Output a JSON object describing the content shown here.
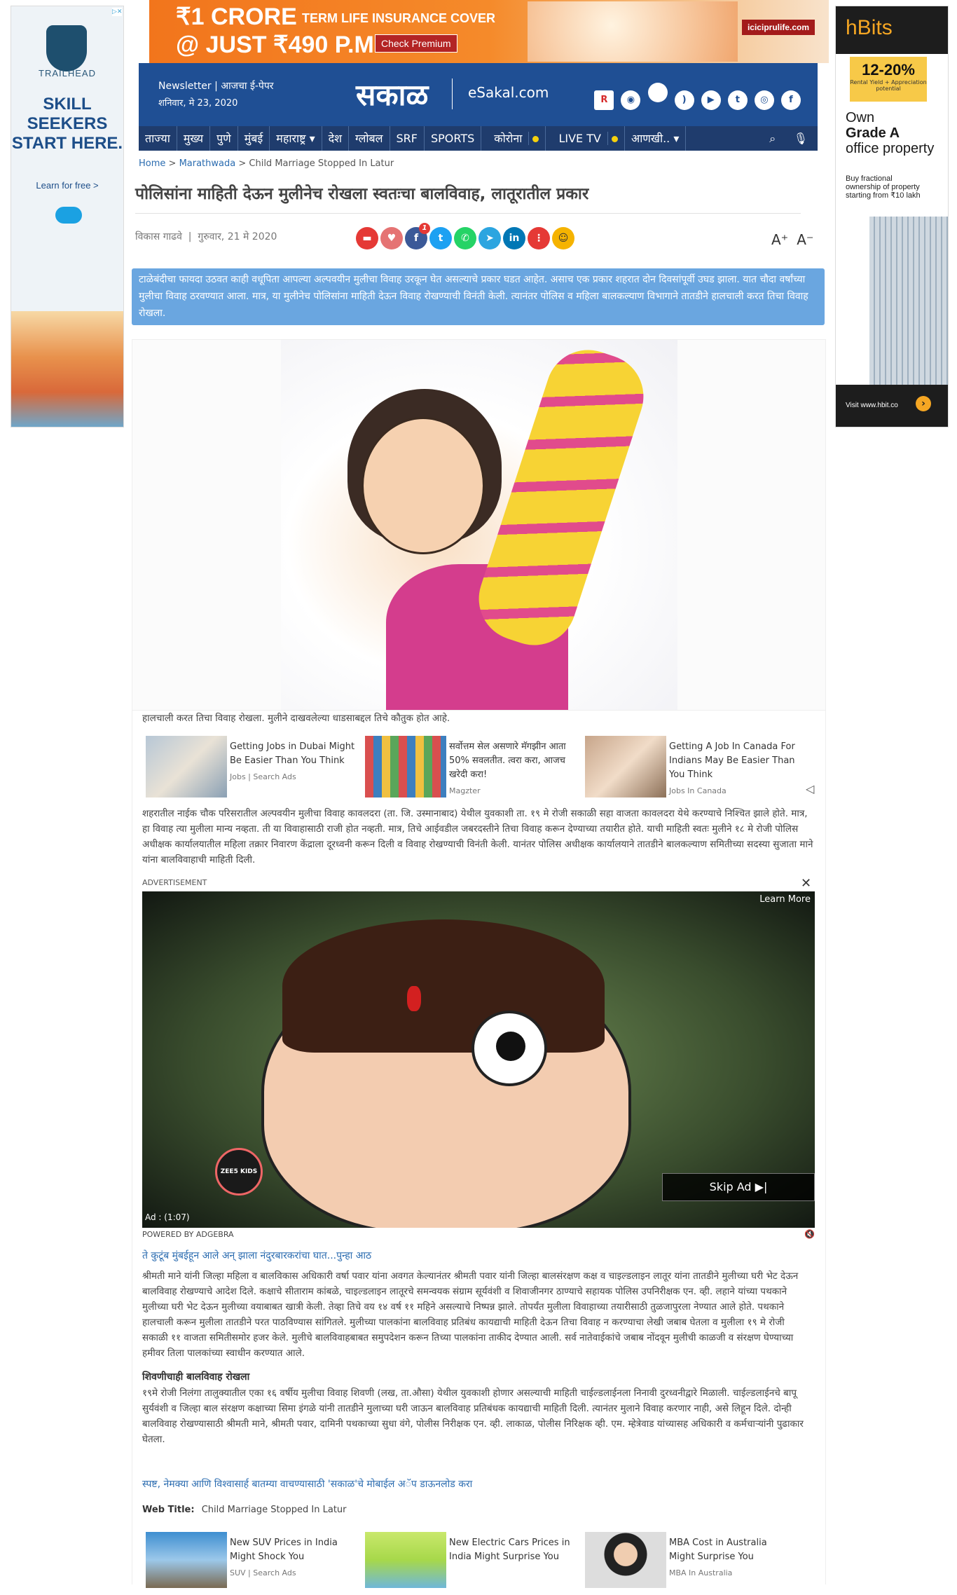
{
  "left_ad": {
    "brand": "TRAILHEAD",
    "headline": "SKILL SEEKERS START HERE.",
    "cta": "Learn for free >",
    "sponsor": "salesforce"
  },
  "top_ad": {
    "line1": "₹1 CRORE",
    "line1_sub": "TERM LIFE INSURANCE COVER",
    "line2": "@ JUST ₹490 P.M.",
    "cta": "Check Premium",
    "brand": "iciciprulife.com"
  },
  "right_ad": {
    "brand": "hBits",
    "rate": "12-20%",
    "rate_sub": "Rental Yield + Appreciation potential",
    "headline_pre": "Own",
    "headline_bold": "Grade A",
    "headline_post": "office property",
    "desc": "Buy fractional ownership of property starting from ₹10 lakh",
    "cta": "Visit www.hbit.co"
  },
  "header": {
    "newsletter": "Newsletter",
    "epaper": "आजचा ई-पेपर",
    "date": "शनिवार, मे 23, 2020",
    "brand": "सकाळ",
    "esakal": "eSakal.com",
    "social_icons": [
      "r-logo-icon",
      "android-icon",
      "apple-icon",
      "rss-icon",
      "youtube-icon",
      "twitter-icon",
      "instagram-icon",
      "facebook-icon"
    ]
  },
  "nav": {
    "items": [
      "ताज्या",
      "मुख्य",
      "पुणे",
      "मुंबई",
      "महाराष्ट्र ▾",
      "देश",
      "ग्लोबल",
      "SRF",
      "SPORTS",
      "कोरोना",
      "LIVE TV",
      "आणखी.. ▾"
    ],
    "search": "⌕",
    "mic": "🎙"
  },
  "breadcrumb": {
    "home": "Home",
    "section": "Marathwada",
    "current": "Child Marriage Stopped In Latur"
  },
  "article": {
    "title": "पोलिसांना माहिती देऊन मुलीनेच रोखला स्वतःचा बालविवाह, लातूरातील प्रकार",
    "author": "विकास गाढवे",
    "date": "गुरुवार, 21 मे 2020",
    "share_count": "1",
    "summary": "टाळेबंदीचा फायदा उठवत काही वधूपिता आपल्या अल्पवयीन मुलीचा विवाह उरकून घेत असल्याचे प्रकार घडत आहेत. असाच एक प्रकार शहरात दोन दिवसांपूर्वी उघड झाला. यात चौदा वर्षांच्या मुलीचा विवाह ठरवण्यात आला. मात्र, या मुलीनेच पोलिसांना माहिती देऊन विवाह रोखण्याची विनंती केली. त्यानंतर पोलिस व महिला बालकल्याण विभागाने तातडीने हालचाली करत तिचा विवाह रोखला.",
    "p1": "हालचाली करत तिचा विवाह रोखला. मुलीने दाखवलेल्या धाडसाबद्दल तिचे कौतुक होत आहे.",
    "p2": "शहरातील नाईक चौक परिसरातील अल्पवयीन मुलीचा विवाह कावलदरा (ता. जि. उस्मानाबाद) येथील युवकाशी ता. १९ मे रोजी सकाळी सहा वाजता कावलदरा येथे करण्याचे निश्चित झाले होते. मात्र, हा विवाह त्या मुलीला मान्य नव्हता. ती या विवाहासाठी राजी होत नव्हती. मात्र, तिचे आईवडील जबरदस्तीने तिचा विवाह करून देण्याच्या तयारीत होते. याची माहिती स्वतः मुलीने १८ मे रोजी पोलिस अधीक्षक कार्यालयातील महिला तक्रार निवारण केंद्राला दूरध्वनी करून दिली व विवाह रोखण्याची विनंती केली. यानंतर पोलिस अधीक्षक कार्यालयाने तातडीने बालकल्याण समितीच्या सदस्या सुजाता माने यांना बालविवाहाची माहिती दिली.",
    "related_link": "ते कुटूंब मुंबईहून आले अन् झाला नंदुरबारकरांचा घात...पुन्हा आठ",
    "p3": "श्रीमती माने यांनी जिल्हा महिला व बालविकास अधिकारी वर्षा पवार यांना अवगत केल्यानंतर श्रीमती पवार यांनी जिल्हा बालसंरक्षण कक्ष व चाइल्डलाइन लातूर यांना तातडीने मुलीच्या घरी भेट देऊन बालविवाह रोखण्याचे आदेश दिले. कक्षाचे सीताराम कांबळे, चाइल्डलाइन लातूरचे समन्वयक संग्राम सूर्यवंशी व शिवाजीनगर ठाण्याचे सहायक पोलिस उपनिरीक्षक एन. व्ही. लहाने यांच्या पथकाने मुलीच्या घरी भेट देऊन मुलीच्या वयाबाबत खात्री केली. तेव्हा तिचे वय १४ वर्ष ११ महिने असल्याचे निष्पन्न झाले. तोपर्यंत मुलीला विवाहाच्या तयारीसाठी तुळजापुरला नेण्यात आले होते. पथकाने हालचाली करून मुलीला तातडीने परत पाठविण्यास सांगितले. मुलीच्या पालकांना बालविवाह प्रतिबंध कायद्याची माहिती देऊन तिचा विवाह न करण्याचा लेखी जबाब घेतला व मुलीला १९ मे रोजी सकाळी ११ वाजता समितीसमोर हजर केले. मुलीचे बालविवाहबाबत समुपदेशन करून तिच्या पालकांना ताकीद देण्यात आली. सर्व नातेवाईकांचे जबाब नोंदवून मुलीची काळजी व संरक्षण घेण्याच्या हमीवर तिला पालकांच्या स्वाधीन करण्यात आले.",
    "subhead": "शिवणीचाही बालविवाह रोखला",
    "p4": "१९मे रोजी निलंगा तालुक्यातील एका १६ वर्षीय मुलीचा विवाह शिवणी (लख, ता.औसा) येथील युवकाशी होणार असल्याची माहिती चाईल्डलाईनला निनावी दुरध्वनीद्वारे मिळाली. चाईल्डलाईनचे बापू सुर्यवंशी व जिल्हा बाल संरक्षण कक्षाच्या सिमा इंगळे यांनी तातडीने मुलाच्या घरी जाऊन बालविवाह प्रतिबंधक कायद्याची माहिती दिली. त्यानंतर मुलाने विवाह करणार नाही, असे लिहून दिले. दोन्ही बालविवाह रोखण्यासाठी श्रीमती माने, श्रीमती पवार, दामिनी पथकाच्या सुधा वंगे, पोलीस निरीक्षक एन. व्ही. लाकाळ, पोलीस निरिक्षक व्ही. एम. म्हेत्रेवाड यांच्यासह अधिकारी व कर्मचाऱ्यांनी पुढाकार घेतला.",
    "app_link": "स्पष्ट, नेमक्या आणि विश्वासार्ह बातम्या वाचण्यासाठी 'सकाळ'चे मोबाईल अॅप डाऊनलोड करा",
    "web_title_label": "Web Title:",
    "web_title": "Child Marriage Stopped In Latur"
  },
  "sponsored_top": [
    {
      "title": "Getting Jobs in Dubai Might Be Easier Than You Think",
      "source": "Jobs | Search Ads"
    },
    {
      "title": "सर्वोत्तम सेल असणारे मॅगझीन आता 50% सवलतीत. त्वरा करा, आजच खरेदी करा!",
      "source": "Magzter"
    },
    {
      "title": "Getting A Job In Canada For Indians May Be Easier Than You Think",
      "source": "Jobs In Canada"
    }
  ],
  "video_ad": {
    "label": "ADVERTISEMENT",
    "close": "✕",
    "learn_more": "Learn More",
    "skip": "Skip Ad ▶|",
    "channel": "ZEE5 KIDS",
    "time": "Ad : (1:07)",
    "powered": "POWERED BY ADGEBRA",
    "mute": "🔇"
  },
  "sponsored_bottom": [
    {
      "title": "New SUV Prices in India Might Shock You",
      "source": "SUV | Search Ads"
    },
    {
      "title": "New Electric Cars Prices in India Might Surprise You",
      "source": ""
    },
    {
      "title": "MBA Cost in Australia Might Surprise You",
      "source": "MBA In Australia"
    }
  ],
  "colors": {
    "header_blue": "#1f4f94",
    "nav_blue": "#1f3c6d",
    "summary_bg": "#6aa6e0",
    "link_blue": "#2b6cb0"
  }
}
